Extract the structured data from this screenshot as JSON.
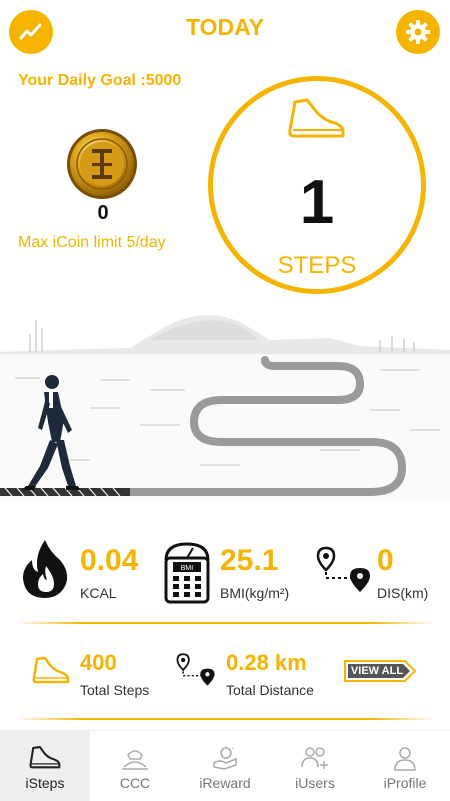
{
  "header": {
    "title": "TODAY",
    "left_icon": "trend-icon",
    "right_icon": "gear-icon"
  },
  "goal": {
    "text": "Your Daily Goal :5000"
  },
  "coin": {
    "count": "0",
    "limit_text": "Max iCoin limit 5/day"
  },
  "steps": {
    "value": "1",
    "label": "STEPS"
  },
  "stats": [
    {
      "value": "0.04",
      "label": "KCAL",
      "icon": "flame-icon"
    },
    {
      "value": "25.1",
      "label": "BMI(kg/m²)",
      "icon": "bmi-scale-icon"
    },
    {
      "value": "0",
      "label": "DIS(km)",
      "icon": "route-icon"
    }
  ],
  "summary": {
    "total_steps_value": "400",
    "total_steps_label": "Total Steps",
    "total_distance_value": "0.28 km",
    "total_distance_label": "Total Distance",
    "view_all": "VIEW ALL"
  },
  "nav": {
    "items": [
      {
        "label": "iSteps",
        "icon": "shoe-icon"
      },
      {
        "label": "CCC",
        "icon": "ccc-icon"
      },
      {
        "label": "iReward",
        "icon": "reward-icon"
      },
      {
        "label": "iUsers",
        "icon": "users-icon"
      },
      {
        "label": "iProfile",
        "icon": "profile-icon"
      }
    ]
  },
  "colors": {
    "accent": "#f5b400",
    "text": "#111111",
    "muted": "#777777"
  }
}
